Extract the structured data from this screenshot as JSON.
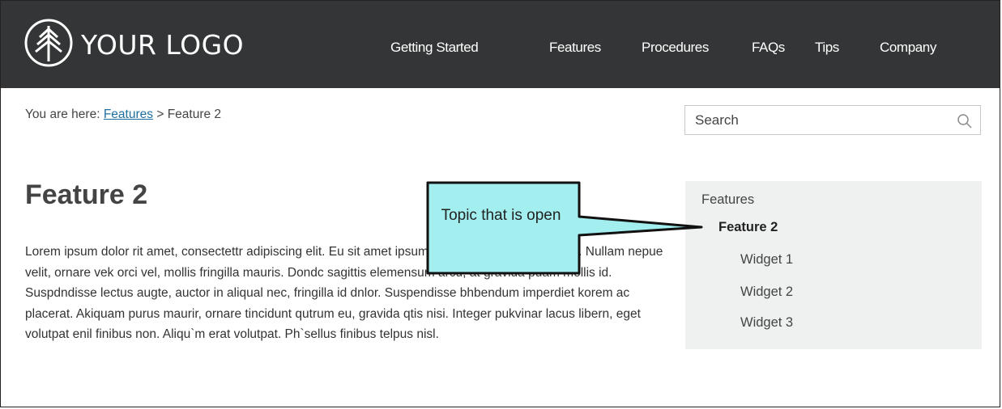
{
  "logo": {
    "text": "YOUR LOGO",
    "icon": "tree-icon"
  },
  "nav": {
    "items": [
      {
        "label": "Getting Started"
      },
      {
        "label": "Features"
      },
      {
        "label": "Procedures"
      },
      {
        "label": "FAQs"
      },
      {
        "label": "Tips"
      },
      {
        "label": "Company"
      }
    ]
  },
  "breadcrumb": {
    "prefix": "You are here:",
    "link": "Features",
    "separator": ">",
    "current": "Feature 2"
  },
  "search": {
    "placeholder": "Search",
    "icon": "search-icon"
  },
  "page": {
    "title": "Feature 2",
    "body": "Lorem ipsum dolor rit amet, consectettr adipiscing elit. Eu sit amet ipsum dolor accumsan `ccumsan. Nullam nepue velit, ornare vek orci vel, mollis fringilla mauris. Dondc sagittis elemensum arcu, at gravida puam mollis id. Suspdndisse lectus augte, auctor in aliqual nec, fringilla id dnlor. Suspendisse bhbendum imperdiet korem ac placerat. Akiquam purus maurir, ornare tincidunt qutrum eu, gravida qtis nisi. Integer pukvinar lacus libern, eget volutpat enil finibus non. Aliqu`m erat volutpat. Ph`sellus finibus telpus nisl."
  },
  "sidenav": {
    "heading": "Features",
    "active": "Feature 2",
    "children": [
      {
        "label": "Widget 1"
      },
      {
        "label": "Widget 2"
      },
      {
        "label": "Widget 3"
      }
    ]
  },
  "callout": {
    "text": "Topic that is open",
    "fill": "#a3eeee"
  },
  "colors": {
    "header_bg": "#333536",
    "sidenav_bg": "#eff1f0",
    "link": "#1f6f9e"
  }
}
